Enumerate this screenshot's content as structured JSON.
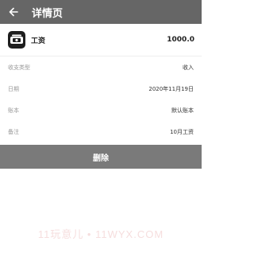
{
  "header": {
    "title": "详情页",
    "back_icon": "arrow-left-icon"
  },
  "record": {
    "category_icon": "wallet-icon",
    "category": "工资",
    "amount": "1000.0"
  },
  "fields": [
    {
      "label": "收支类型",
      "value": "收入"
    },
    {
      "label": "日期",
      "value": "2020年11月19日"
    },
    {
      "label": "账本",
      "value": "默认账本"
    },
    {
      "label": "备注",
      "value": "10月工资"
    }
  ],
  "delete_label": "删除",
  "watermark": "11玩意儿 • 11WYX.COM",
  "colors": {
    "appbar": "#666666",
    "delete_button": "#7a7a7a"
  }
}
